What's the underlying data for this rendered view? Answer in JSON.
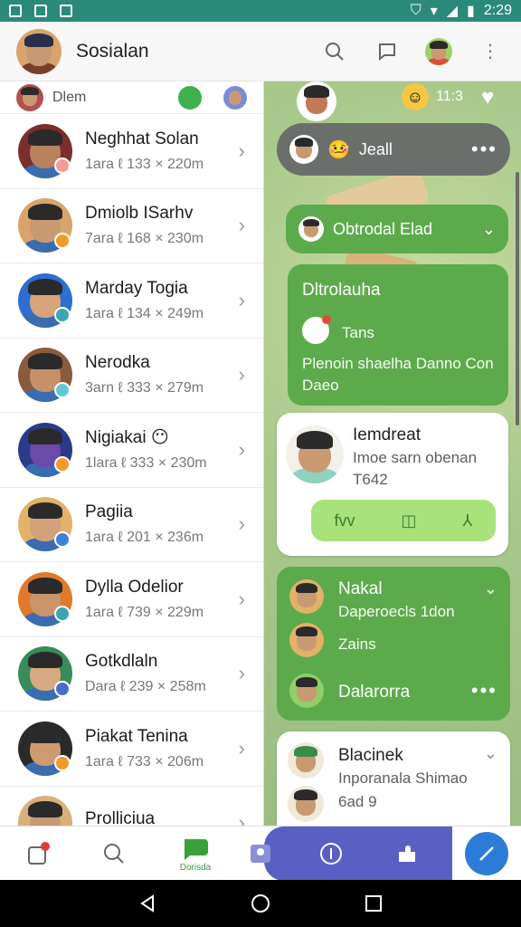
{
  "status_bar": {
    "time": "2:29"
  },
  "app": {
    "title": "Sosialan"
  },
  "list": {
    "peek_label": "Dlem",
    "contacts": [
      {
        "name": "Neghhat Solan",
        "sub": "1ara ℓ 133 × 220m",
        "badge": "#f29b9b",
        "face": "#b8825e",
        "bg": "#7a2e2e"
      },
      {
        "name": "Dmiolb ISarhv",
        "sub": "7ara ℓ 168 × 230m",
        "badge": "#f09a2a",
        "face": "#c99a72",
        "bg": "#d9a46c"
      },
      {
        "name": "Marday Togia",
        "sub": "1ara ℓ 134 × 249m",
        "badge": "#3aa6b5",
        "face": "#d7a47c",
        "bg": "#2c6fd1"
      },
      {
        "name": "Nerodka",
        "sub": "3arn ℓ 333 × 279m",
        "badge": "#62c8d6",
        "face": "#c6906a",
        "bg": "#8a5a3c"
      },
      {
        "name": "Nigiakai",
        "emoji": "😶",
        "sub": "1lara ℓ 333 × 230m",
        "badge": "#f09a2a",
        "face": "#6a4aa8",
        "bg": "#2b3a8a"
      },
      {
        "name": "Pagiia",
        "sub": "1ara ℓ 201 × 236m",
        "badge": "#3b82d6",
        "face": "#d3a07a",
        "bg": "#e0b26a"
      },
      {
        "name": "Dylla Odelior",
        "sub": "1ara ℓ 739 × 229m",
        "badge": "#3aa6b5",
        "face": "#c9946c",
        "bg": "#e07a2a"
      },
      {
        "name": "Gotkdlaln",
        "sub": "Dara ℓ 239 × 258m",
        "badge": "#4a6cc8",
        "face": "#d6aa80",
        "bg": "#3a8a5a"
      },
      {
        "name": "Piakat Tenina",
        "sub": "1ara ℓ 733 × 206m",
        "badge": "#f09a2a",
        "face": "#d09a70",
        "bg": "#2a2a2a"
      },
      {
        "name": "Prolliciua",
        "sub": "",
        "badge": "#3b82d6",
        "face": "#c99a72",
        "bg": "#d9b07a"
      }
    ]
  },
  "right": {
    "top_count": "11:3",
    "pill_dark": {
      "emoji": "🤒",
      "label": "Jeall"
    },
    "pill_green": {
      "label": "Obtrodal Elad"
    },
    "card1": {
      "title": "Dltrolauha",
      "icon_label": "Tans",
      "line1": "Plenoin shaelha Danno Con",
      "line2": "Daeo"
    },
    "card2": {
      "title": "Iemdreat",
      "line1": "Imoe sarn obenan",
      "line2": "T642",
      "actions": [
        "fvv",
        "◫",
        "⅄"
      ]
    },
    "card3": {
      "title": "Nakal",
      "line1": "Daperoecls 1don",
      "line2": "Zains",
      "line3": "Dalarorra"
    },
    "card4": {
      "title": "Blacinek",
      "line1": "Inporanala Shimao",
      "line2": "6ad 9"
    }
  },
  "bottom_nav": {
    "active_label": "Dorisda"
  },
  "colors": {
    "status_bar": "#2a8a7a",
    "green": "#5daa4c",
    "purple": "#5a5fc4",
    "fab": "#2d7bd8"
  }
}
